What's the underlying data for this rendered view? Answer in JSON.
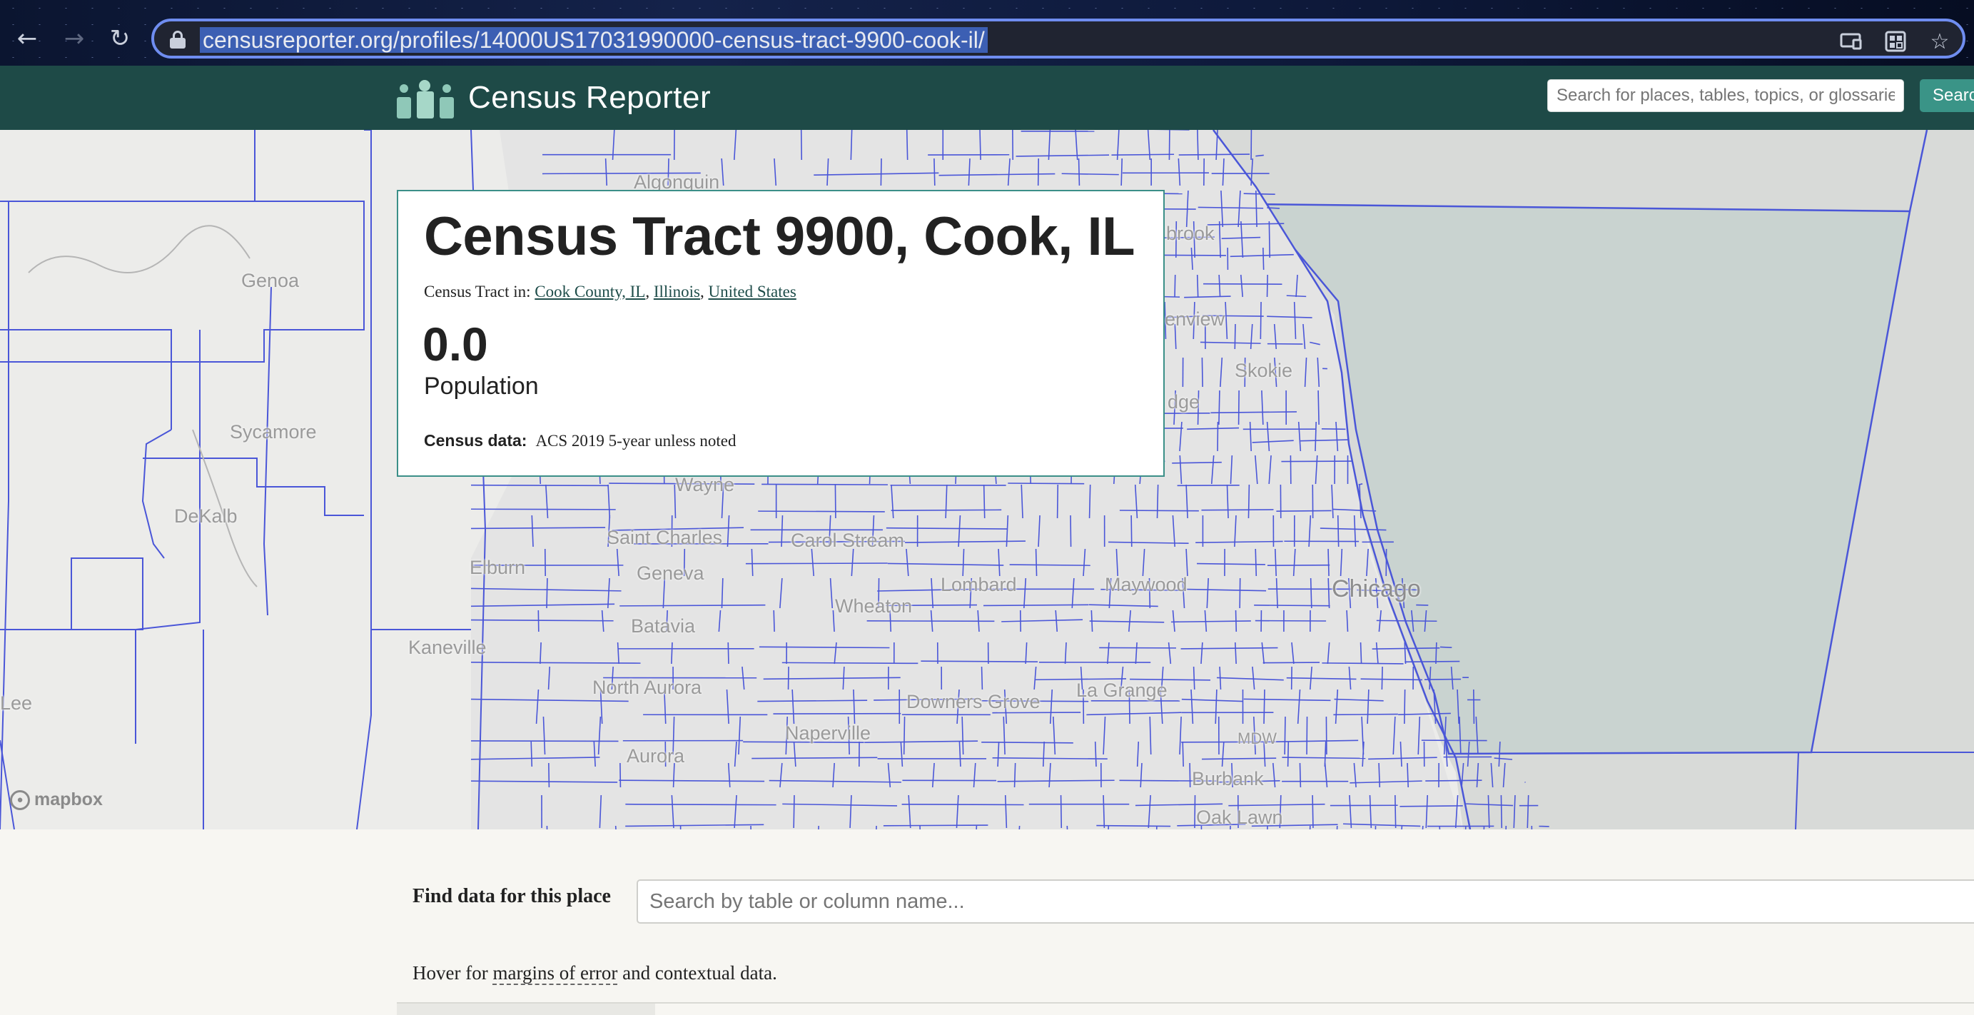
{
  "browser": {
    "url": "censusreporter.org/profiles/14000US17031990000-census-tract-9900-cook-il/",
    "icons": [
      "back-icon",
      "forward-icon",
      "reload-icon",
      "lock-icon",
      "cast-icon",
      "extensions-icon",
      "star-icon"
    ]
  },
  "header": {
    "site_title": "Census Reporter",
    "search_placeholder": "Search for places, tables, topics, or glossaries",
    "search_button": "Search"
  },
  "map": {
    "attribution": "mapbox",
    "labels": {
      "algonquin": "Algonquin",
      "genoa": "Genoa",
      "sycamore": "Sycamore",
      "dekalb": "DeKalb",
      "wayne": "Wayne",
      "saint_charles": "Saint Charles",
      "carol_stream": "Carol Stream",
      "elburn": "Elburn",
      "geneva": "Geneva",
      "lombard": "Lombard",
      "maywood": "Maywood",
      "chicago": "Chicago",
      "wheaton": "Wheaton",
      "batavia": "Batavia",
      "kaneville": "Kaneville",
      "north_aurora": "North Aurora",
      "downers_grove": "Downers Grove",
      "la_grange": "La Grange",
      "naperville": "Naperville",
      "aurora": "Aurora",
      "burbank": "Burbank",
      "lee": "Lee",
      "skokie": "Skokie",
      "glenview": "enview",
      "northbrook": "brook",
      "park_ridge": "dge",
      "midway": "MDW",
      "oak_lawn": "Oak Lawn"
    }
  },
  "profile": {
    "title": "Census Tract 9900, Cook, IL",
    "parents_prefix": "Census Tract in:",
    "parents": [
      "Cook County, IL",
      "Illinois",
      "United States"
    ],
    "stat_value": "0.0",
    "stat_label": "Population",
    "census_data_label": "Census data:",
    "census_data_value": "ACS 2019 5-year unless noted"
  },
  "find_data": {
    "label": "Find data for this place",
    "placeholder": "Search by table or column name..."
  },
  "hover_note": {
    "prefix": "Hover for ",
    "link": "margins of error",
    "suffix": " and contextual data."
  }
}
